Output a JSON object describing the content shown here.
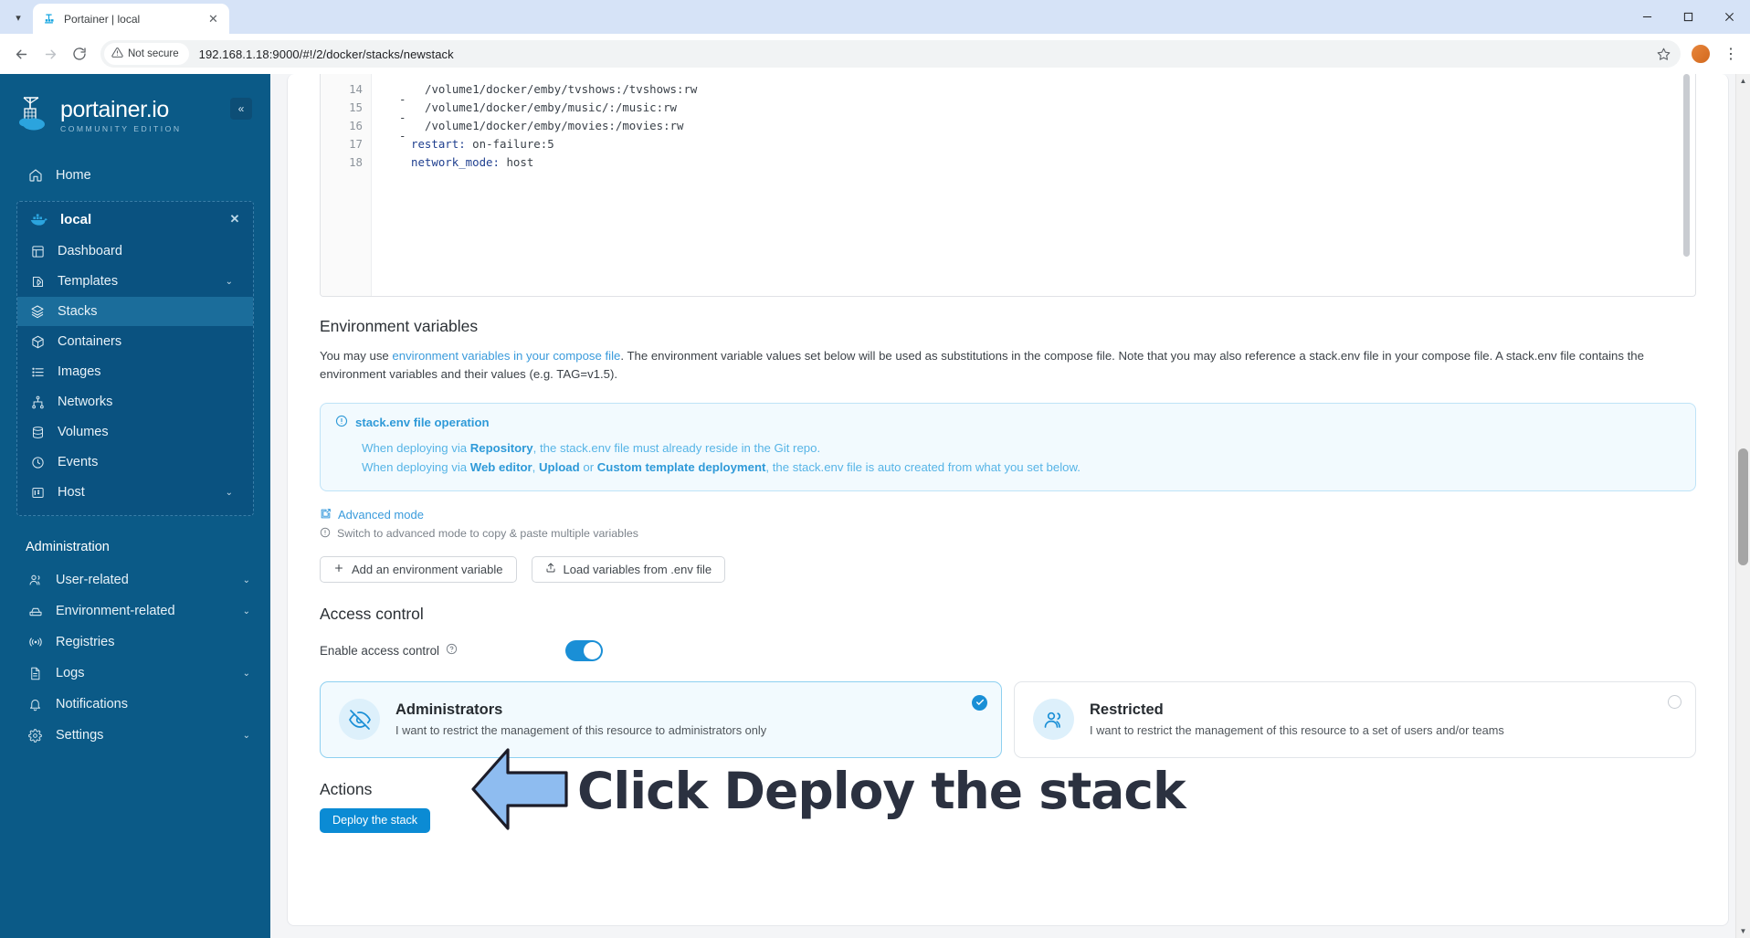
{
  "browser": {
    "tab": {
      "title": "Portainer | local",
      "favicon_icon": "portainer-favicon",
      "close_icon": "close-icon"
    },
    "tab_dropdown_icon": "chevron-down-icon",
    "window": {
      "minimize": "minimize-icon",
      "maximize": "maximize-icon",
      "close": "close-icon"
    },
    "nav": {
      "back_icon": "arrow-left-icon",
      "forward_icon": "arrow-right-icon",
      "reload_icon": "reload-icon"
    },
    "omnibox": {
      "security_label": "Not secure",
      "security_icon": "warning-triangle-icon",
      "url": "192.168.1.18:9000/#!/2/docker/stacks/newstack",
      "star_icon": "star-icon"
    },
    "profile_avatar": "user-avatar",
    "menu_icon": "kebab-menu-icon"
  },
  "sidebar": {
    "logo": {
      "main": "portainer.io",
      "sub": "COMMUNITY EDITION",
      "icon": "portainer-crane-logo"
    },
    "collapse_icon": "chevron-double-left-icon",
    "home": {
      "label": "Home",
      "icon": "home-icon"
    },
    "environment": {
      "name": "local",
      "icon": "docker-whale-icon",
      "close_icon": "close-icon",
      "items": [
        {
          "label": "Dashboard",
          "icon": "dashboard-icon",
          "chevron": "",
          "active": false
        },
        {
          "label": "Templates",
          "icon": "templates-icon",
          "chevron": "⌄",
          "active": false
        },
        {
          "label": "Stacks",
          "icon": "stacks-icon",
          "chevron": "",
          "active": true
        },
        {
          "label": "Containers",
          "icon": "containers-icon",
          "chevron": "",
          "active": false
        },
        {
          "label": "Images",
          "icon": "images-icon",
          "chevron": "",
          "active": false
        },
        {
          "label": "Networks",
          "icon": "networks-icon",
          "chevron": "",
          "active": false
        },
        {
          "label": "Volumes",
          "icon": "volumes-icon",
          "chevron": "",
          "active": false
        },
        {
          "label": "Events",
          "icon": "events-clock-icon",
          "chevron": "",
          "active": false
        },
        {
          "label": "Host",
          "icon": "host-icon",
          "chevron": "⌄",
          "active": false
        }
      ]
    },
    "admin_section_title": "Administration",
    "admin_items": [
      {
        "label": "User-related",
        "icon": "users-icon",
        "chevron": "⌄"
      },
      {
        "label": "Environment-related",
        "icon": "environment-icon",
        "chevron": "⌄"
      },
      {
        "label": "Registries",
        "icon": "registries-icon",
        "chevron": ""
      },
      {
        "label": "Logs",
        "icon": "logs-icon",
        "chevron": "⌄"
      },
      {
        "label": "Notifications",
        "icon": "bell-icon",
        "chevron": ""
      },
      {
        "label": "Settings",
        "icon": "gear-icon",
        "chevron": "⌄"
      }
    ]
  },
  "editor": {
    "lines": [
      {
        "num": "14",
        "indent": "      ",
        "dash": "- ",
        "key": "",
        "value": "/volume1/docker/emby/tvshows:/tvshows:rw"
      },
      {
        "num": "15",
        "indent": "      ",
        "dash": "- ",
        "key": "",
        "value": "/volume1/docker/emby/music/:/music:rw"
      },
      {
        "num": "16",
        "indent": "      ",
        "dash": "- ",
        "key": "",
        "value": "/volume1/docker/emby/movies:/movies:rw"
      },
      {
        "num": "17",
        "indent": "    ",
        "dash": "",
        "key": "restart:",
        "value": " on-failure:5"
      },
      {
        "num": "18",
        "indent": "    ",
        "dash": "",
        "key": "network_mode:",
        "value": " host"
      }
    ]
  },
  "env_vars": {
    "title": "Environment variables",
    "desc_part1": "You may use ",
    "desc_link": "environment variables in your compose file",
    "desc_part2": ". The environment variable values set below will be used as substitutions in the compose file. Note that you may also reference a stack.env file in your compose file. A stack.env file contains the environment variables and their values (e.g. TAG=v1.5).",
    "callout": {
      "icon": "info-circle-icon",
      "title": "stack.env file operation",
      "line1_a": "When deploying via ",
      "line1_b": "Repository",
      "line1_c": ", the stack.env file must already reside in the Git repo.",
      "line2_a": "When deploying via ",
      "line2_b": "Web editor",
      "line2_c": ", ",
      "line2_d": "Upload",
      "line2_e": " or ",
      "line2_f": "Custom template deployment",
      "line2_g": ", the stack.env file is auto created from what you set below."
    },
    "advanced_mode": {
      "label": "Advanced mode",
      "icon": "edit-square-icon"
    },
    "advanced_hint": {
      "label": "Switch to advanced mode to copy & paste multiple variables",
      "icon": "info-circle-icon"
    },
    "buttons": [
      {
        "label": "Add an environment variable",
        "icon": "plus-icon"
      },
      {
        "label": "Load variables from .env file",
        "icon": "upload-icon"
      }
    ]
  },
  "access_control": {
    "title": "Access control",
    "toggle_label": "Enable access control",
    "toggle_help_icon": "question-circle-icon",
    "toggle_on": true,
    "options": [
      {
        "title": "Administrators",
        "subtitle": "I want to restrict the management of this resource to administrators only",
        "icon": "eye-off-icon",
        "selected": true,
        "radio_icon": "check-circle-icon"
      },
      {
        "title": "Restricted",
        "subtitle": "I want to restrict the management of this resource to a set of users and/or teams",
        "icon": "users-group-icon",
        "selected": false,
        "radio_icon": "radio-empty-icon"
      }
    ]
  },
  "actions": {
    "title": "Actions",
    "deploy_label": "Deploy the stack"
  },
  "annotation": {
    "text": "Click Deploy the stack",
    "arrow_icon": "left-arrow-annotation",
    "arrow_fill": "#8ebcf0",
    "arrow_stroke": "#1c1c28",
    "text_color": "#2b3140"
  },
  "colors": {
    "sidebar_bg": "#0b5a87",
    "sidebar_active": "#1b6d9b",
    "accent": "#1a8fd6",
    "deploy_btn": "#0b8bd4",
    "link": "#3a9bdc"
  }
}
